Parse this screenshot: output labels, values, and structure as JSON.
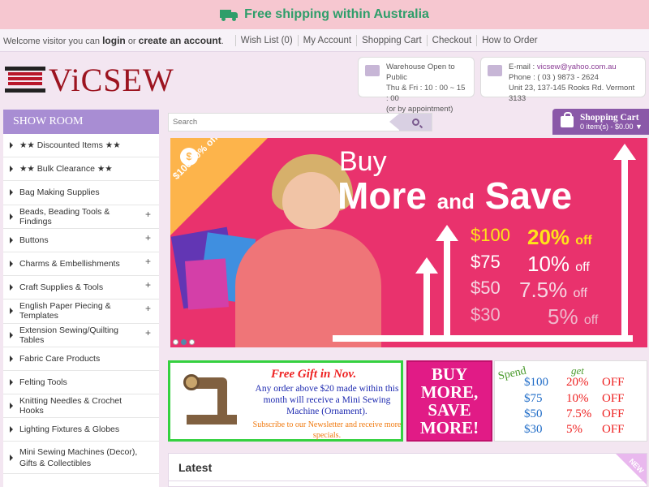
{
  "banner": {
    "text": "Free shipping within Australia",
    "icon": "truck-icon",
    "color": "#2e9e6a"
  },
  "nav": {
    "welcome_prefix": "Welcome visitor you can",
    "login": "login",
    "or": "or",
    "create_account": "create an account",
    "dot": ".",
    "links": [
      "Wish List (0)",
      "My Account",
      "Shopping Cart",
      "Checkout",
      "How to Order"
    ]
  },
  "header": {
    "logo_text": "ViCSEW",
    "warehouse": {
      "title": "Warehouse Open to Public",
      "hours": "Thu & Fri : 10 : 00 ~ 15 : 00",
      "note": "(or by appointment)",
      "icon": "truck-icon"
    },
    "contact": {
      "email_label": "E-mail :",
      "email": "vicsew@yahoo.com.au",
      "phone": "Phone : ( 03 ) 9873 - 2624",
      "address": "Unit 23, 137-145 Rooks Rd. Vermont 3133",
      "icon": "mail-icon"
    }
  },
  "sidebar": {
    "title": "SHOW ROOM",
    "items": [
      {
        "label": "★★ Discounted Items ★★",
        "plus": ""
      },
      {
        "label": "★★ Bulk Clearance ★★",
        "plus": ""
      },
      {
        "label": "Bag Making Supplies",
        "plus": ""
      },
      {
        "label": "Beads, Beading Tools & Findings",
        "plus": "+"
      },
      {
        "label": "Buttons",
        "plus": "+"
      },
      {
        "label": "Charms & Embellishments",
        "plus": "+"
      },
      {
        "label": "Craft Supplies & Tools",
        "plus": "+"
      },
      {
        "label": "English Paper Piecing & Templates",
        "plus": "+"
      },
      {
        "label": "Extension Sewing/Quilting Tables",
        "plus": "+"
      },
      {
        "label": "Fabric Care Products",
        "plus": ""
      },
      {
        "label": "Felting Tools",
        "plus": ""
      },
      {
        "label": "Knitting Needles & Crochet Hooks",
        "plus": ""
      },
      {
        "label": "Lighting Fixtures & Globes",
        "plus": ""
      },
      {
        "label": "Mini Sewing Machines (Decor), Gifts & Collectibles",
        "plus": ""
      }
    ]
  },
  "search": {
    "placeholder": "Search"
  },
  "cart": {
    "title": "Shopping Cart",
    "summary": "0 item(s) - $0.00",
    "caret": "▼"
  },
  "hero": {
    "ribbon": "$100 20% off",
    "coin": "$",
    "line1": "Buy",
    "line2a": "More",
    "line2b": "and",
    "line2c": "Save",
    "tiers": [
      {
        "spend": "$100",
        "pct": "20%",
        "off": "off",
        "color": "#ffe21a"
      },
      {
        "spend": "$75",
        "pct": "10%",
        "off": "off",
        "color": "#ffffff"
      },
      {
        "spend": "$50",
        "pct": "7.5%",
        "off": "off",
        "color": "#f6d6e2"
      },
      {
        "spend": "$30",
        "pct": "5%",
        "off": "off",
        "color": "#f0b8cc"
      }
    ],
    "dots_active": 1
  },
  "gift": {
    "title": "Free Gift in Nov.",
    "body": "Any order above $20 made within this month will receive a Mini Sewing Machine (Ornament).",
    "foot": "Subscribe to our Newsletter and receive more specials."
  },
  "bms": {
    "l1": "BUY",
    "l2": "MORE,",
    "l3": "SAVE",
    "l4": "MORE!"
  },
  "spend_table": {
    "h_spend": "Spend",
    "h_get": "get",
    "rows": [
      {
        "spend": "$100",
        "pct": "20%",
        "off": "OFF"
      },
      {
        "spend": "$75",
        "pct": "10%",
        "off": "OFF"
      },
      {
        "spend": "$50",
        "pct": "7.5%",
        "off": "OFF"
      },
      {
        "spend": "$30",
        "pct": "5%",
        "off": "OFF"
      }
    ]
  },
  "latest": {
    "label": "Latest",
    "badge": "NEW"
  }
}
